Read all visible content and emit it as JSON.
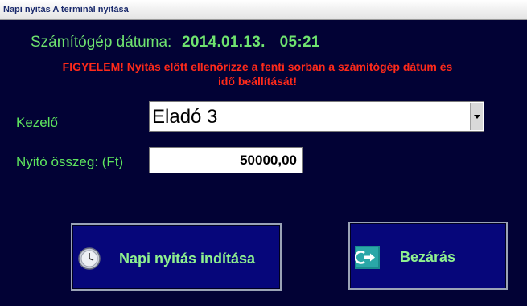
{
  "window": {
    "title": "Napi nyitás A terminál nyitása"
  },
  "date_row": {
    "label": "Számítógép dátuma:",
    "date": "2014.01.13.",
    "time": "05:21"
  },
  "warning": {
    "line1": "FIGYELEM! Nyitás előtt ellenőrizze a fenti sorban a számítógép dátum és",
    "line2": "idő beállítását!"
  },
  "form": {
    "operator": {
      "label": "Kezelő",
      "value": "Eladó 3"
    },
    "amount": {
      "label": "Nyitó összeg: (Ft)",
      "value": "50000,00"
    }
  },
  "buttons": {
    "start": {
      "label": "Napi nyitás indítása",
      "icon": "clock-icon"
    },
    "close": {
      "label": "Bezárás",
      "icon": "exit-arrow-icon"
    }
  },
  "colors": {
    "background": "#020235",
    "label_green": "#6fe36f",
    "warning_red": "#ff2a1a",
    "button_blue": "#06067a"
  }
}
